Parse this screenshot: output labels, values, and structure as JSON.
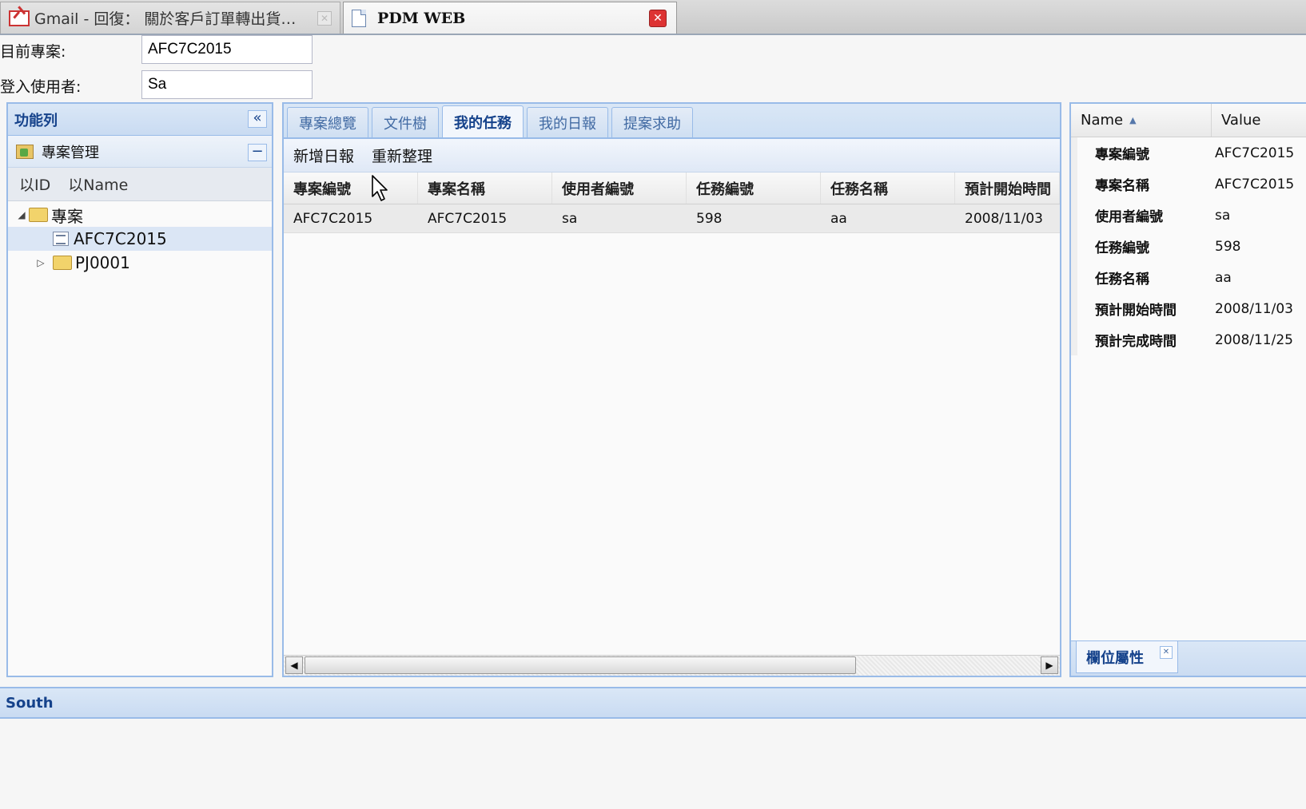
{
  "browser": {
    "tabs": [
      {
        "label": "Gmail - 回復： 關於客戶訂單轉出貨…",
        "icon": "gmail-icon"
      },
      {
        "label": "PDM WEB",
        "icon": "document-icon"
      }
    ]
  },
  "header": {
    "project_label": "目前專案:",
    "project_value": "AFC7C2015",
    "user_label": "登入使用者:",
    "user_value": "Sa"
  },
  "sidebar": {
    "title": "功能列",
    "section": "專案管理",
    "search_modes": [
      "以ID",
      "以Name"
    ],
    "tree": {
      "root": "專案",
      "children": [
        "AFC7C2015",
        "PJ0001"
      ]
    }
  },
  "main": {
    "tabs": [
      "專案總覽",
      "文件樹",
      "我的任務",
      "我的日報",
      "提案求助"
    ],
    "active_tab": "我的任務",
    "toolbar": [
      "新增日報",
      "重新整理"
    ],
    "columns": [
      "專案編號",
      "專案名稱",
      "使用者編號",
      "任務編號",
      "任務名稱",
      "預計開始時間"
    ],
    "rows": [
      [
        "AFC7C2015",
        "AFC7C2015",
        "sa",
        "598",
        "aa",
        "2008/11/03"
      ]
    ]
  },
  "properties": {
    "name_header": "Name",
    "value_header": "Value",
    "rows": [
      {
        "name": "專案編號",
        "value": "AFC7C2015"
      },
      {
        "name": "專案名稱",
        "value": "AFC7C2015"
      },
      {
        "name": "使用者編號",
        "value": "sa"
      },
      {
        "name": "任務編號",
        "value": "598"
      },
      {
        "name": "任務名稱",
        "value": "aa"
      },
      {
        "name": "預計開始時間",
        "value": "2008/11/03"
      },
      {
        "name": "預計完成時間",
        "value": "2008/11/25"
      }
    ],
    "footer_tab": "欄位屬性"
  },
  "south": {
    "title": "South"
  },
  "colors": {
    "panel_border": "#99bbe8",
    "header_text": "#15428b",
    "close_red": "#dd3333"
  }
}
